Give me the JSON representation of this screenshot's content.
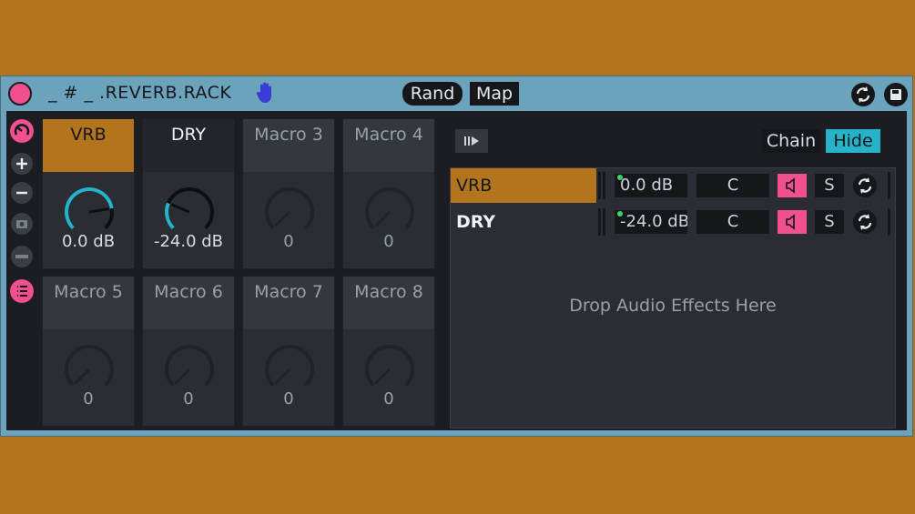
{
  "window": {
    "title": "_ # _ .REVERB.RACK"
  },
  "toolbar": {
    "rand_label": "Rand",
    "map_label": "Map"
  },
  "colors": {
    "accent": "#b2741d",
    "power": "#f0508c",
    "knob_active": "#26b3c9",
    "panel": "#1b1d22"
  },
  "macros": [
    {
      "label": "VRB",
      "value": "0.0 dB",
      "state": "active",
      "knob_level": 0.8
    },
    {
      "label": "DRY",
      "value": "-24.0 dB",
      "state": "lit",
      "knob_level": 0.25
    },
    {
      "label": "Macro 3",
      "value": "0",
      "state": "off",
      "knob_level": 0
    },
    {
      "label": "Macro 4",
      "value": "0",
      "state": "off",
      "knob_level": 0
    },
    {
      "label": "Macro 5",
      "value": "0",
      "state": "off",
      "knob_level": 0
    },
    {
      "label": "Macro 6",
      "value": "0",
      "state": "off",
      "knob_level": 0
    },
    {
      "label": "Macro 7",
      "value": "0",
      "state": "off",
      "knob_level": 0
    },
    {
      "label": "Macro 8",
      "value": "0",
      "state": "off",
      "knob_level": 0
    }
  ],
  "chain_panel": {
    "chain_label": "Chain",
    "hide_label": "Hide",
    "chains": [
      {
        "name": "VRB",
        "volume": "0.0 dB",
        "pan": "C",
        "solo": "S",
        "selected": true
      },
      {
        "name": "DRY",
        "volume": "-24.0 dB",
        "pan": "C",
        "solo": "S",
        "selected": false
      }
    ],
    "drop_text": "Drop Audio Effects Here"
  },
  "icons": {
    "title_hand": "hand-icon",
    "header_right": [
      "sync-icon",
      "save-icon"
    ],
    "sidebar": [
      "macro-knob-icon",
      "add-icon",
      "remove-icon",
      "camera-icon",
      "minus-bar-icon",
      "list-icon"
    ]
  }
}
